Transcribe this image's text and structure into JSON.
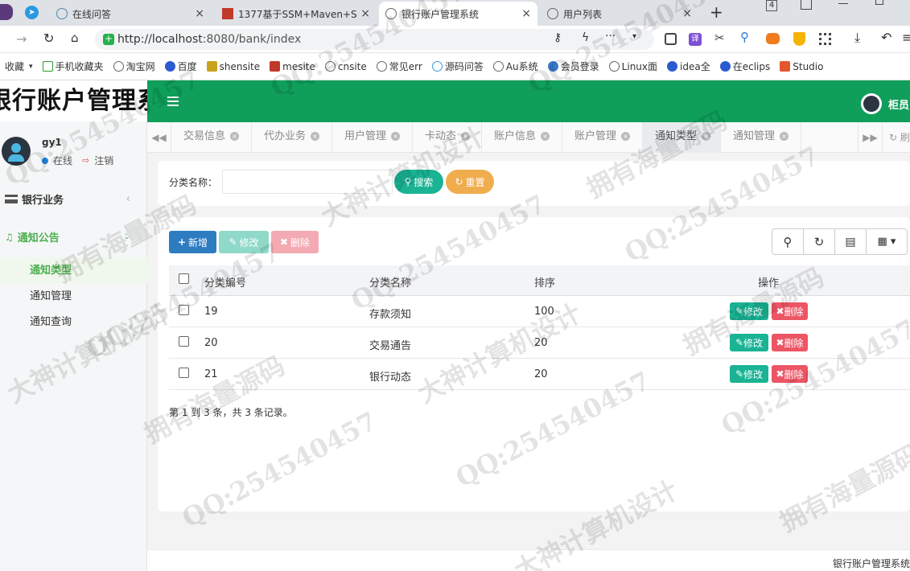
{
  "browser": {
    "tabs": [
      {
        "label": "在线问答"
      },
      {
        "label": "1377基于SSM+Maven+S"
      },
      {
        "label": "银行账户管理系统"
      },
      {
        "label": "用户列表"
      }
    ],
    "tab_counter": "4",
    "url_host": "http://localhost",
    "url_rest": ":8080/bank/index",
    "bookmarks": [
      "收藏",
      "手机收藏夹",
      "淘宝网",
      "百度",
      "shensite",
      "mesite",
      "cnsite",
      "常见err",
      "源码问答",
      "Au系统",
      "会员登录",
      "Linux面",
      "idea全",
      "在eclips",
      "Studio"
    ]
  },
  "app": {
    "logo": "银行账户管理系统",
    "header_user": "柜员",
    "footer": "银行账户管理系统"
  },
  "sidebar": {
    "user": {
      "name": "gy1",
      "status": "在线",
      "logout": "注销"
    },
    "groups": [
      {
        "label": "银行业务"
      },
      {
        "label": "通知公告"
      }
    ],
    "items": [
      {
        "label": "通知类型"
      },
      {
        "label": "通知管理"
      },
      {
        "label": "通知查询"
      }
    ]
  },
  "page_tabs": [
    "交易信息",
    "代办业务",
    "用户管理",
    "卡动态",
    "账户信息",
    "账户管理",
    "通知类型",
    "通知管理"
  ],
  "page_tabs_refresh": "刷",
  "search": {
    "label": "分类名称：",
    "value": "",
    "search_button": "搜索",
    "reset_button": "重置"
  },
  "toolbar": {
    "add": "新增",
    "edit": "修改",
    "delete": "删除"
  },
  "table": {
    "headers": [
      "分类编号",
      "分类名称",
      "排序",
      "操作"
    ],
    "rows": [
      {
        "id": "19",
        "name": "存款须知",
        "sort": "100",
        "edit": "修改",
        "delete": "删除"
      },
      {
        "id": "20",
        "name": "交易通告",
        "sort": "20",
        "edit": "修改",
        "delete": "删除"
      },
      {
        "id": "21",
        "name": "银行动态",
        "sort": "20",
        "edit": "修改",
        "delete": "删除"
      }
    ],
    "summary": "第 1 到 3 条，共 3 条记录。"
  },
  "watermarks": [
    "QQ:254540457",
    "拥有海量源码",
    "大神计算机设计"
  ],
  "colors": {
    "header_green": "#0f9f5b",
    "primary_blue": "#2d7cc1",
    "success_teal": "#1ab394",
    "warning_orange": "#f0ad4e",
    "danger_red": "#ed5565",
    "active_green": "#4caf50"
  }
}
